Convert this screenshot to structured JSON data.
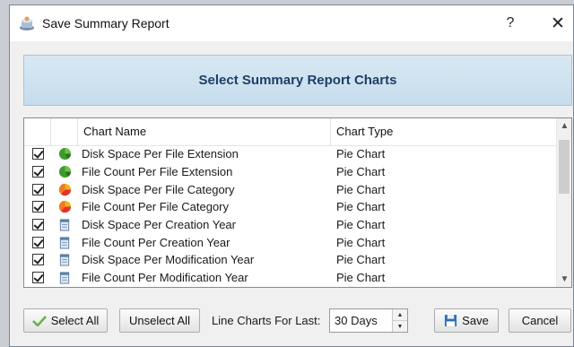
{
  "window": {
    "title": "Save Summary Report",
    "help_label": "?",
    "close_label": "✕"
  },
  "banner": {
    "title": "Select Summary Report Charts"
  },
  "list": {
    "headers": {
      "name": "Chart Name",
      "type": "Chart Type"
    },
    "rows": [
      {
        "name": "Disk Space Per File Extension",
        "type": "Pie Chart",
        "icon": "pie-green-icon",
        "checked": true
      },
      {
        "name": "File Count Per File Extension",
        "type": "Pie Chart",
        "icon": "pie-green-icon",
        "checked": true
      },
      {
        "name": "Disk Space Per File Category",
        "type": "Pie Chart",
        "icon": "pie-multicolor-icon",
        "checked": true
      },
      {
        "name": "File Count Per File Category",
        "type": "Pie Chart",
        "icon": "pie-multicolor-icon",
        "checked": true
      },
      {
        "name": "Disk Space Per Creation Year",
        "type": "Pie Chart",
        "icon": "calendar-icon",
        "checked": true
      },
      {
        "name": "File Count Per Creation Year",
        "type": "Pie Chart",
        "icon": "calendar-icon",
        "checked": true
      },
      {
        "name": "Disk Space Per Modification Year",
        "type": "Pie Chart",
        "icon": "calendar-icon",
        "checked": true
      },
      {
        "name": "File Count Per Modification Year",
        "type": "Pie Chart",
        "icon": "calendar-icon",
        "checked": true
      }
    ]
  },
  "footer": {
    "select_all": "Select All",
    "unselect_all": "Unselect All",
    "line_charts_label": "Line Charts For Last:",
    "line_charts_value": "30 Days",
    "save": "Save",
    "cancel": "Cancel"
  }
}
